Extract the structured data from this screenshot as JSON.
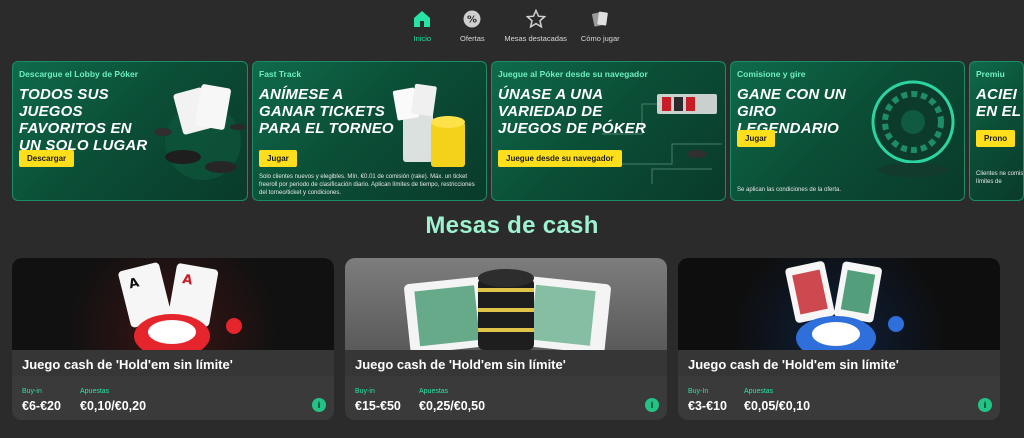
{
  "nav": {
    "items": [
      {
        "label": "Inicio",
        "icon": "home-icon",
        "active": true
      },
      {
        "label": "Ofertas",
        "icon": "percent-badge-icon"
      },
      {
        "label": "Mesas destacadas",
        "icon": "star-icon"
      },
      {
        "label": "Cómo jugar",
        "icon": "cards-icon"
      }
    ]
  },
  "promos": [
    {
      "kicker": "Descargue el Lobby de Póker",
      "headline": "TODOS SUS JUEGOS FAVORITOS EN UN SOLO LUGAR",
      "cta": "Descargar",
      "fine": ""
    },
    {
      "kicker": "Fast Track",
      "headline": "ANÍMESE A GANAR TICKETS PARA EL TORNEO",
      "cta": "Jugar",
      "fine": "Solo clientes nuevos y elegibles. Mín. €0.01 de comisión (rake). Máx. un ticket freeroll por periodo de clasificación diario. Aplican límites de tiempo, restricciones del torneo/ticket y condiciones."
    },
    {
      "kicker": "Juegue al Póker desde su navegador",
      "headline": "ÚNASE A UNA VARIEDAD DE JUEGOS DE PÓKER",
      "cta": "Juegue desde su navegador",
      "fine": ""
    },
    {
      "kicker": "Comisione y gire",
      "headline": "GANE CON UN GIRO LEGENDARIO",
      "cta": "Jugar",
      "fine": "Se aplican las condiciones de la oferta."
    },
    {
      "kicker": "Premiu",
      "headline": "ACIEI EN EL",
      "cta": "Prono",
      "fine": "Clientes ne comisión ( límites de"
    }
  ],
  "section_title": "Mesas de cash",
  "cash_tables": [
    {
      "name": "Juego cash de 'Hold'em sin límite'",
      "buyin_label": "Buy-in",
      "buyin": "€6-€20",
      "stakes_label": "Apuestas",
      "stakes": "€0,10/€0,20",
      "chip_color": "#e5252b"
    },
    {
      "name": "Juego cash de 'Hold'em sin límite'",
      "buyin_label": "Buy-in",
      "buyin": "€15-€50",
      "stakes_label": "Apuestas",
      "stakes": "€0,25/€0,50",
      "chip_color": "#2a2a2a"
    },
    {
      "name": "Juego cash de 'Hold'em sin límite'",
      "buyin_label": "Buy-In",
      "buyin": "€3-€10",
      "stakes_label": "Apuestas",
      "stakes": "€0,05/€0,10",
      "chip_color": "#2f6fdc"
    }
  ],
  "info_glyph": "i",
  "colors": {
    "accent": "#27e4a6",
    "cta": "#ffdf1b",
    "promo_bg": "#0b4f37"
  }
}
